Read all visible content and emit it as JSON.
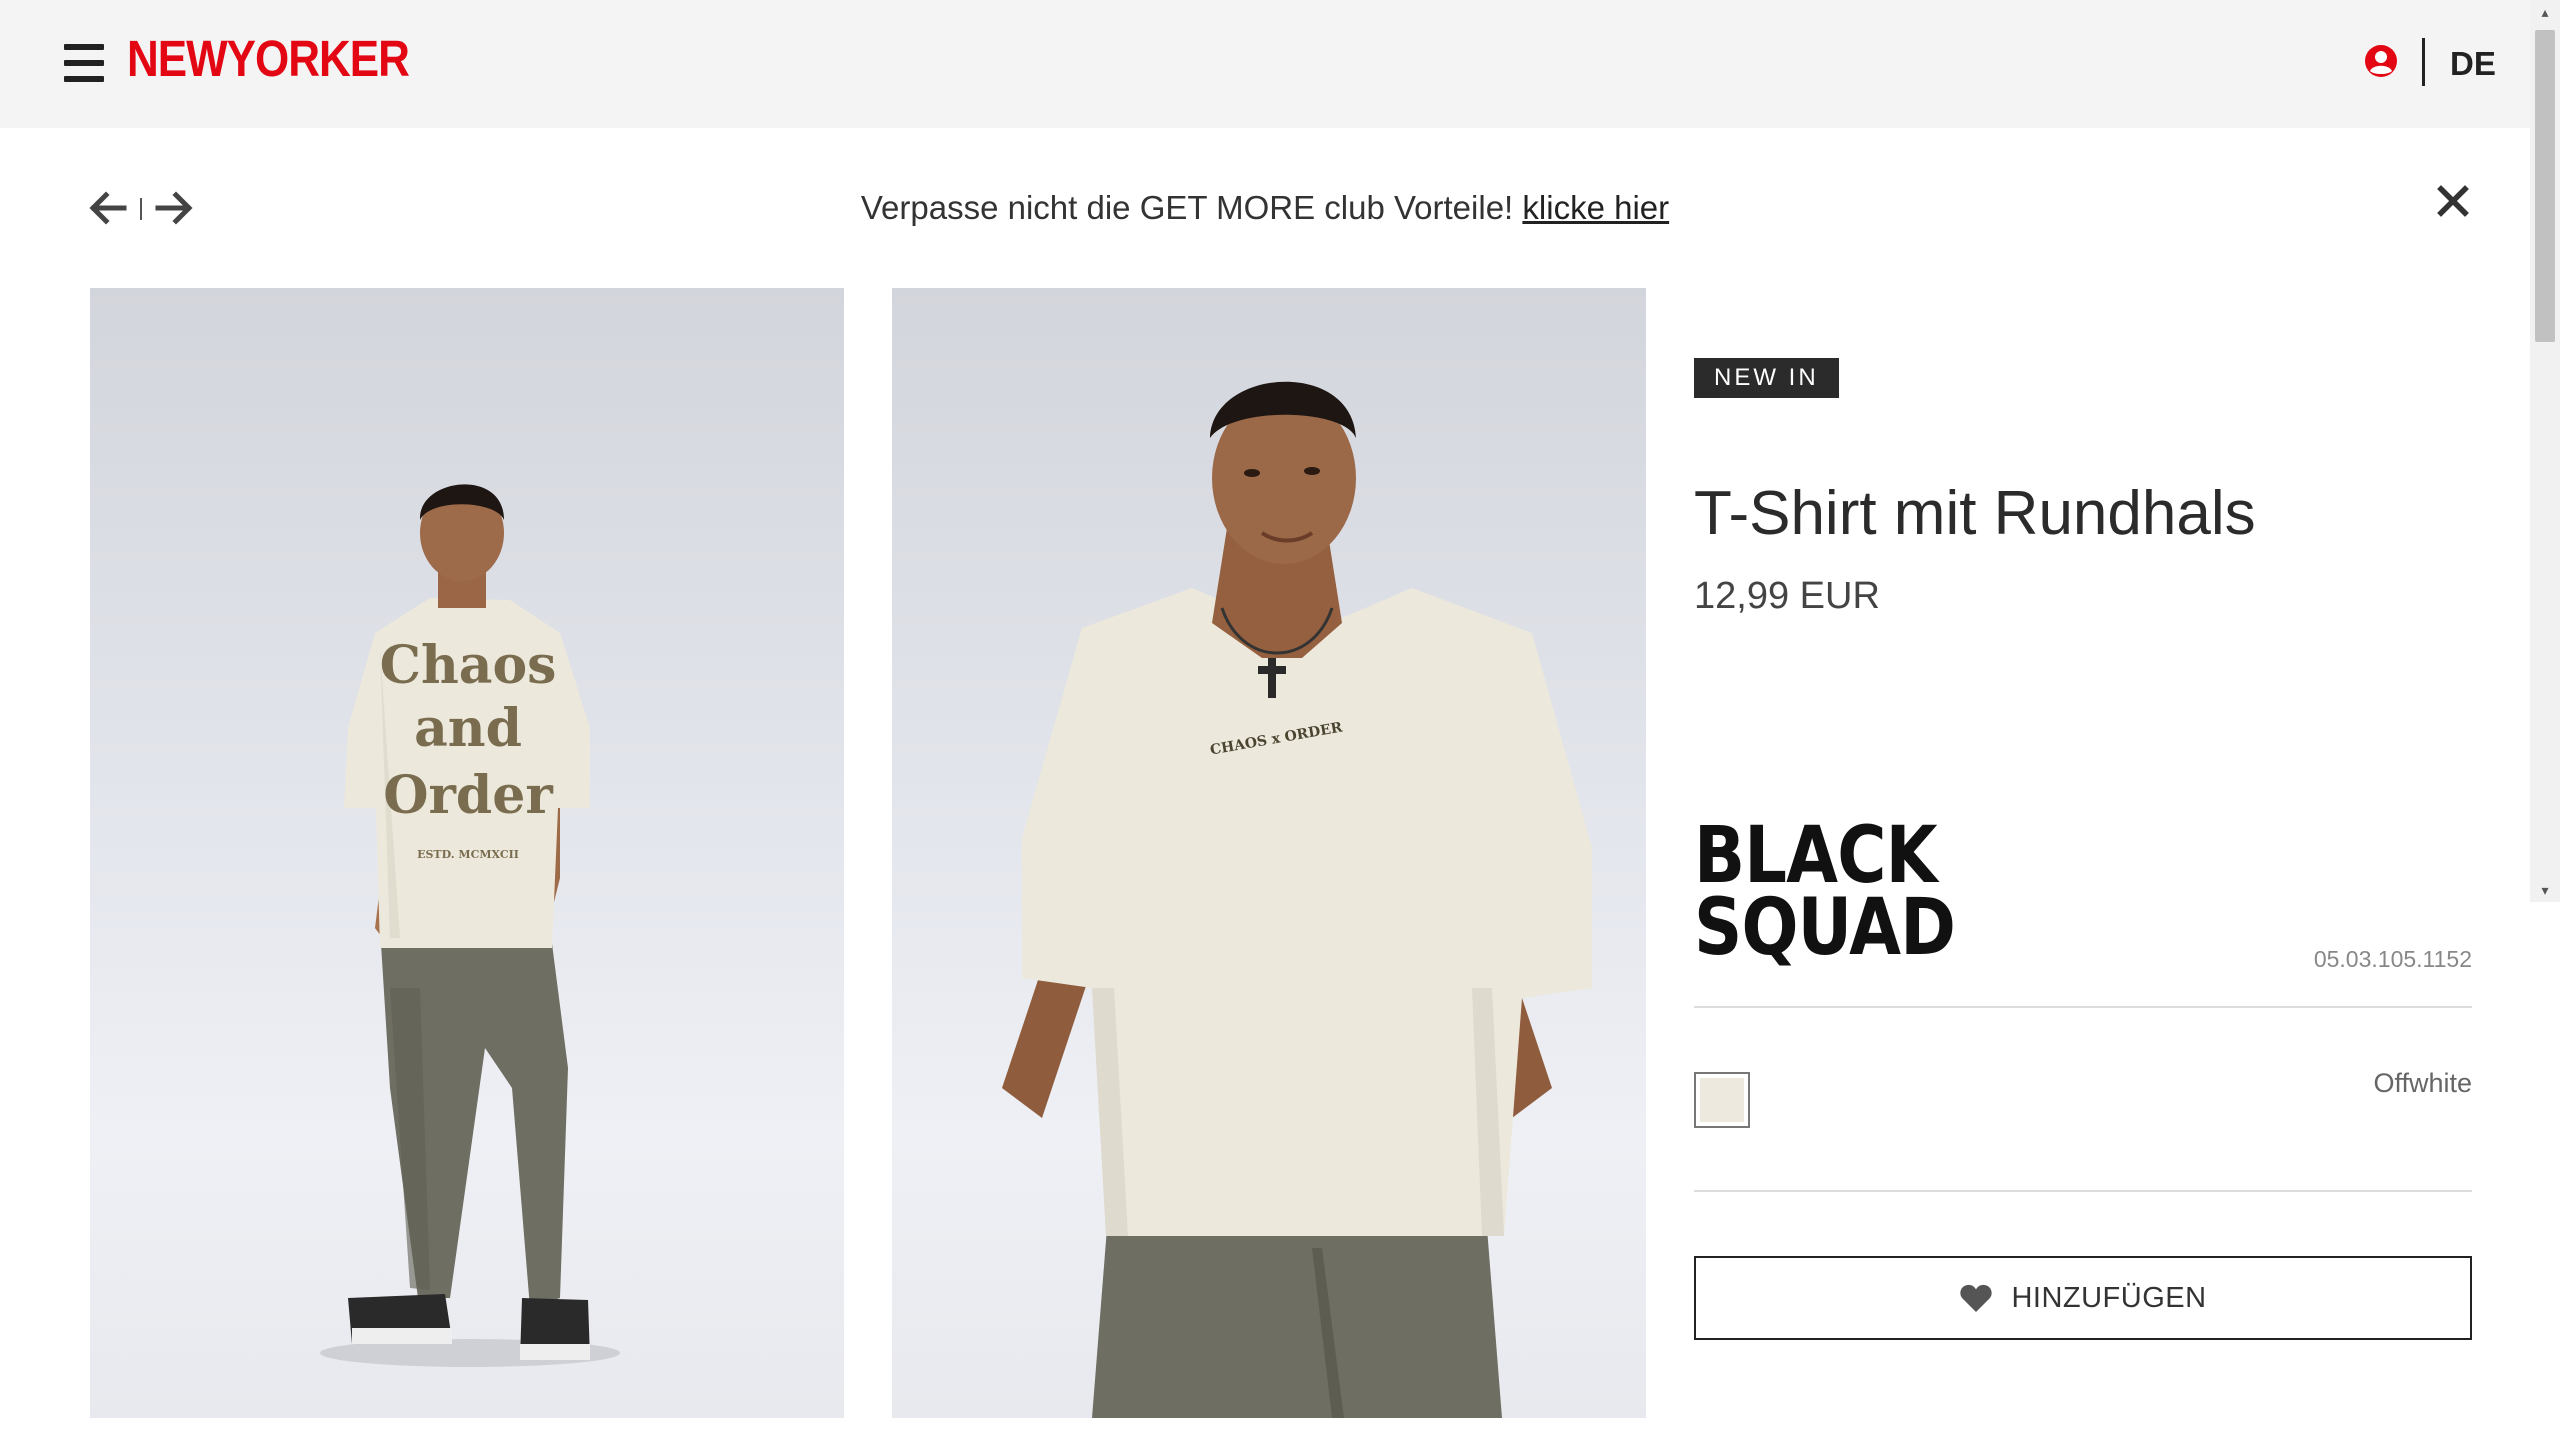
{
  "header": {
    "menu_icon": "hamburger-menu-icon",
    "logo_text": "NEWYORKER",
    "user_icon": "user-account-icon",
    "language": "DE",
    "brand_color": "#e30613"
  },
  "promo": {
    "prev_icon": "arrow-left-icon",
    "next_icon": "arrow-right-icon",
    "text": "Verpasse nicht die GET MORE club Vorteile!",
    "link": "klicke hier",
    "close_icon": "close-icon"
  },
  "gallery": {
    "images": [
      {
        "description": "back view model wearing offwhite t-shirt"
      },
      {
        "description": "front view model wearing offwhite t-shirt"
      }
    ],
    "print_back": [
      "Chaos",
      "and",
      "Order"
    ],
    "print_back_small": "ESTD. MCMXCII",
    "print_front": "CHAOS x ORDER"
  },
  "product": {
    "badge": "NEW IN",
    "title": "T-Shirt mit Rundhals",
    "price": "12,99 EUR",
    "brand_lines": [
      "BLACK",
      "SQUAD"
    ],
    "sku": "05.03.105.1152",
    "color_name": "Offwhite",
    "color_hex": "#ede9df",
    "add_label": "HINZUFÜGEN",
    "heart_icon": "heart-icon"
  }
}
